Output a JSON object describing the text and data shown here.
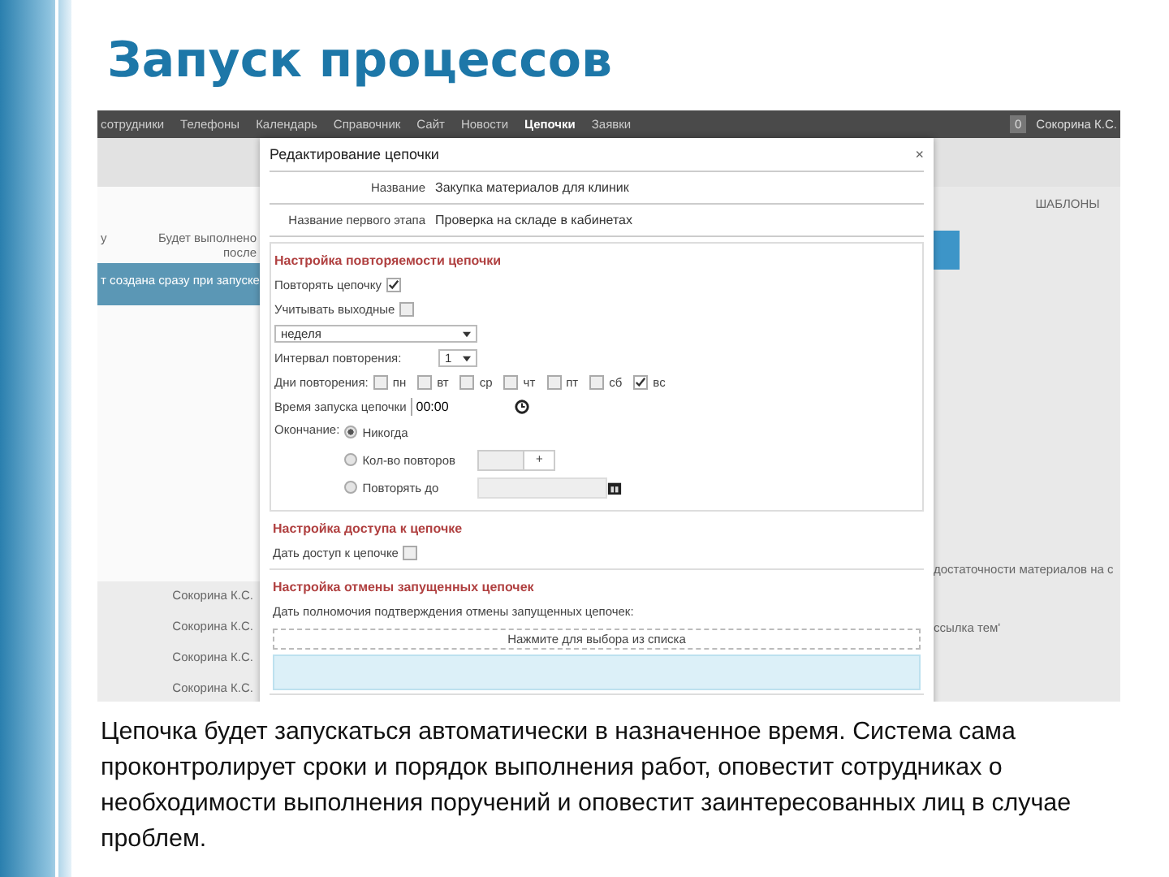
{
  "slide": {
    "title": "Запуск процессов",
    "caption": "Цепочка будет запускаться автоматически в назначенное время. Система сама проконтролирует сроки и порядок выполнения работ, оповестит сотрудниках о необходимости выполнения поручений и оповестит заинтересованных лиц в случае проблем."
  },
  "app": {
    "nav": {
      "items": [
        {
          "label": "сотрудники",
          "selected": false
        },
        {
          "label": "Телефоны",
          "selected": false
        },
        {
          "label": "Календарь",
          "selected": false
        },
        {
          "label": "Справочник",
          "selected": false
        },
        {
          "label": "Сайт",
          "selected": false
        },
        {
          "label": "Новости",
          "selected": false
        },
        {
          "label": "Цепочки",
          "selected": true
        },
        {
          "label": "Заявки",
          "selected": false
        }
      ],
      "badge": "0",
      "user": "Сокорина К.С."
    },
    "left": {
      "cut_label": "у",
      "note": "Будет выполнено",
      "note_2": "после",
      "banner": "т создана сразу при запуске",
      "names": [
        "Сокорина К.С.",
        "Сокорина К.С.",
        "Сокорина К.С.",
        "Сокорина К.С."
      ]
    },
    "right": {
      "tab": "ШАБЛОНЫ",
      "texts": [
        "достаточности материалов на с",
        "ссылка тем'"
      ]
    }
  },
  "dialog": {
    "title": "Редактирование цепочки",
    "close": "×",
    "fields": [
      {
        "label": "Название",
        "value": "Закупка материалов для клиник"
      },
      {
        "label": "Название первого этапа",
        "value": "Проверка на складе в кабинетах"
      }
    ],
    "sections": [
      {
        "heading": "Настройка повторяемости цепочки",
        "rows": [
          {
            "kind": "checkbox",
            "label": "Повторять цепочку",
            "checked": true
          },
          {
            "kind": "checkbox",
            "label": "Учитывать выходные",
            "checked": false
          },
          {
            "kind": "select",
            "value": "неделя"
          },
          {
            "kind": "inline_select",
            "label": "Интервал повторения:",
            "value": "1"
          },
          {
            "kind": "days",
            "label": "Дни повторения:",
            "days": [
              {
                "label": "пн",
                "checked": false
              },
              {
                "label": "вт",
                "checked": false
              },
              {
                "label": "ср",
                "checked": false
              },
              {
                "label": "чт",
                "checked": false
              },
              {
                "label": "пт",
                "checked": false
              },
              {
                "label": "сб",
                "checked": false
              },
              {
                "label": "вс",
                "checked": true
              }
            ]
          },
          {
            "kind": "time",
            "label": "Время запуска цепочки",
            "value": "00:00"
          },
          {
            "kind": "radios",
            "label": "Окончание:",
            "options": [
              {
                "label": "Никогда",
                "selected": true,
                "kind": "none"
              },
              {
                "label": "Кол-во повторов",
                "selected": false,
                "kind": "spinner",
                "spin": "+"
              },
              {
                "label": "Повторять до",
                "selected": false,
                "kind": "date"
              }
            ]
          }
        ]
      },
      {
        "heading": "Настройка доступа к цепочке",
        "rows": [
          {
            "kind": "checkbox",
            "label": "Дать доступ к цепочке",
            "checked": false
          }
        ]
      },
      {
        "heading": "Настройка отмены запущенных цепочек",
        "rows": [
          {
            "kind": "text",
            "text": "Дать полномочия подтверждения отмены запущенных цепочек:"
          },
          {
            "kind": "picker",
            "placeholder": "Нажмите для выбора из списка"
          },
          {
            "kind": "note"
          }
        ]
      }
    ]
  }
}
